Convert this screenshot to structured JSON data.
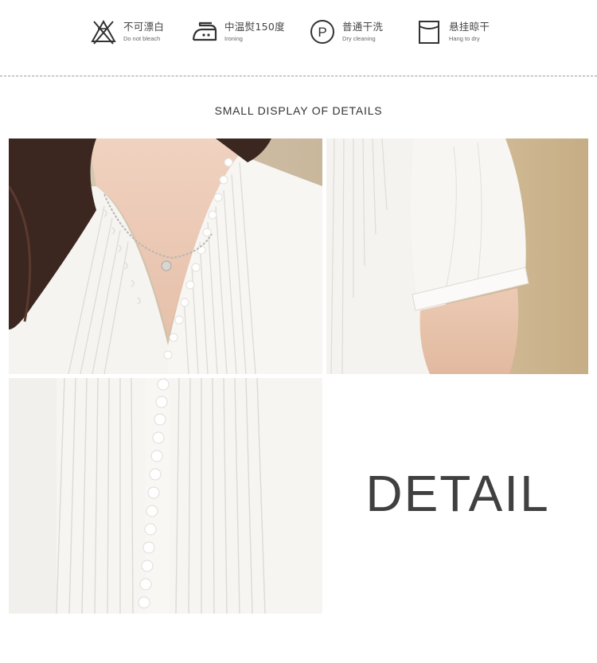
{
  "care_instructions": [
    {
      "icon": "no-bleach-icon",
      "cn": "不可漂白",
      "en": "Do not bleach"
    },
    {
      "icon": "iron-icon",
      "cn": "中温熨150度",
      "en": "Ironing"
    },
    {
      "icon": "dry-clean-icon",
      "cn": "普通干洗",
      "en": "Dry cleaning"
    },
    {
      "icon": "hang-dry-icon",
      "cn": "悬挂晾干",
      "en": "Hang to dry"
    }
  ],
  "dry_clean_letter": "P",
  "section_title": "SMALL DISPLAY OF DETAILS",
  "detail_word": "DETAIL",
  "photos": [
    {
      "name": "photo-neckline-closeup"
    },
    {
      "name": "photo-sleeve-closeup"
    },
    {
      "name": "photo-pleats-buttons-closeup"
    }
  ],
  "colors": {
    "text": "#333333",
    "detail": "#404040",
    "divider": "#9a9a9a",
    "blouse": "#f6f5f2",
    "backdrop": "#cbb89a"
  }
}
